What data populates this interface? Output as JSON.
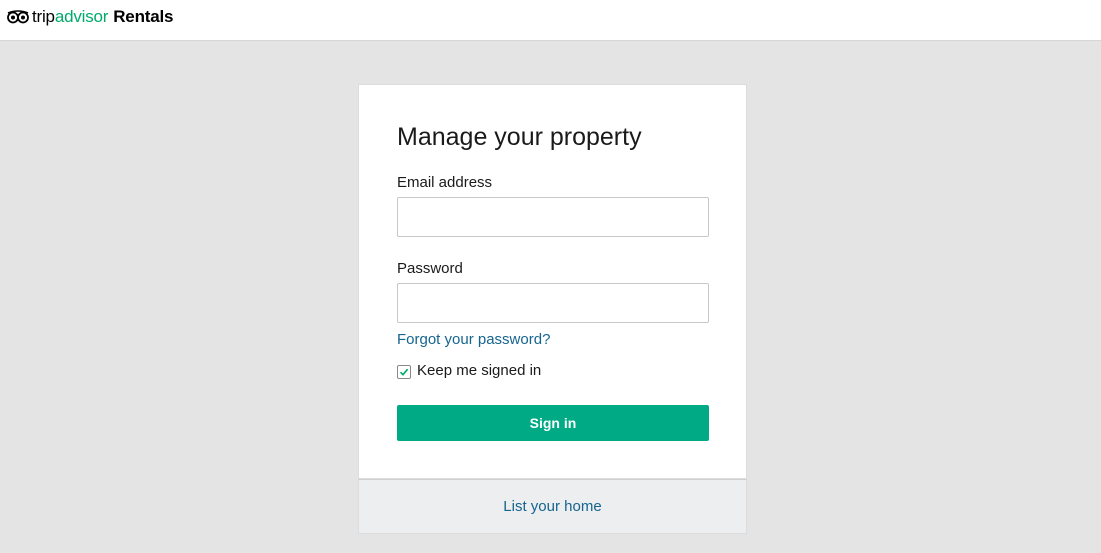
{
  "header": {
    "logo_icon": "owl-eyes-icon",
    "brand_trip": "trip",
    "brand_advisor": "advisor",
    "brand_rentals": "Rentals",
    "accent_color": "#00aa6c"
  },
  "login": {
    "title": "Manage your property",
    "email_label": "Email address",
    "email_value": "",
    "password_label": "Password",
    "password_value": "",
    "forgot_link": "Forgot your password?",
    "keep_signed_in_label": "Keep me signed in",
    "keep_signed_in_checked": true,
    "sign_in_label": "Sign in",
    "button_color": "#00aa85"
  },
  "footer": {
    "list_home_link": "List your home"
  }
}
